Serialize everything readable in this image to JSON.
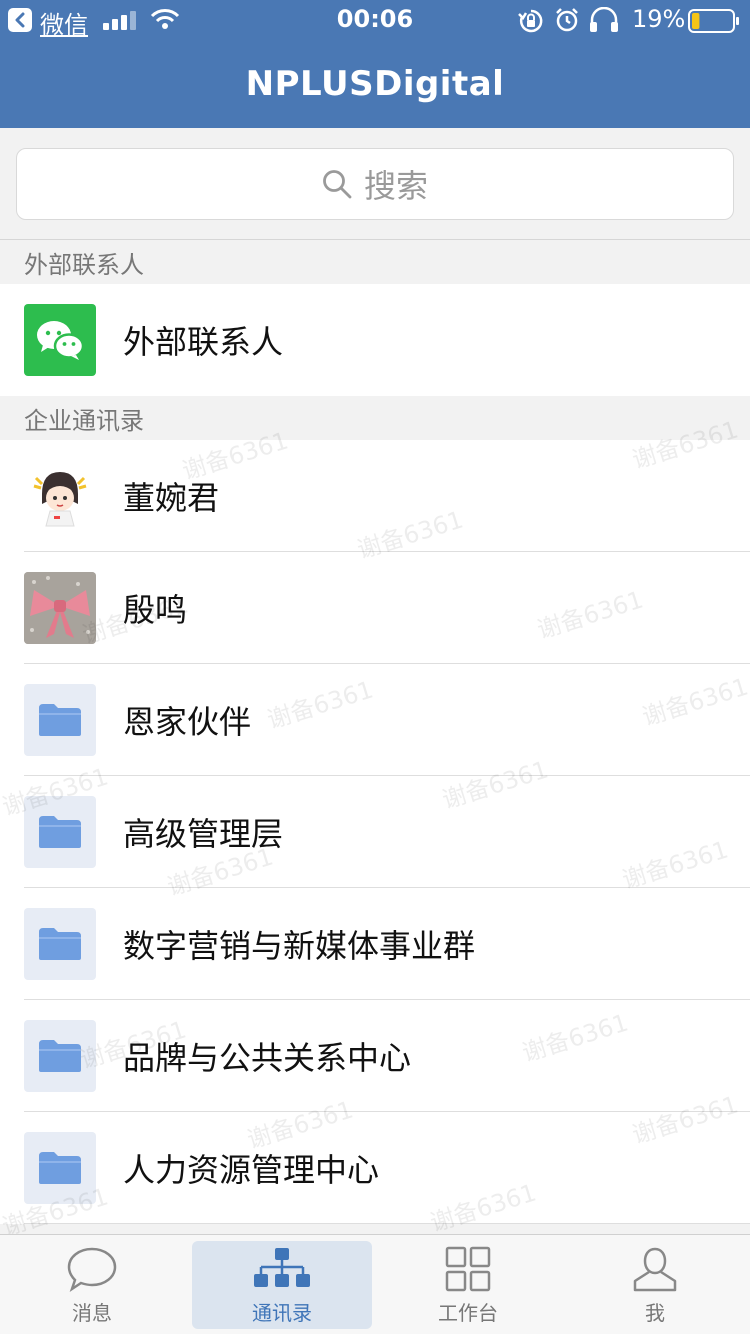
{
  "status_bar": {
    "back_app": "微信",
    "time": "00:06",
    "battery_percent": "19%",
    "battery_level": 0.19,
    "icons": [
      "back-icon",
      "signal-icon",
      "wifi-icon",
      "rotation-lock-icon",
      "alarm-icon",
      "headphone-icon",
      "battery-icon"
    ]
  },
  "header": {
    "title": "NPLUSDigital"
  },
  "search": {
    "placeholder": "搜索"
  },
  "sections": {
    "external": {
      "title": "外部联系人",
      "items": [
        {
          "label": "外部联系人",
          "icon": "wechat-icon"
        }
      ]
    },
    "directory": {
      "title": "企业通讯录",
      "items": [
        {
          "label": "董婉君",
          "icon": "cartoon-avatar"
        },
        {
          "label": "殷鸣",
          "icon": "bow-avatar"
        },
        {
          "label": "恩家伙伴",
          "icon": "folder-icon"
        },
        {
          "label": "高级管理层",
          "icon": "folder-icon"
        },
        {
          "label": "数字营销与新媒体事业群",
          "icon": "folder-icon"
        },
        {
          "label": "品牌与公共关系中心",
          "icon": "folder-icon"
        },
        {
          "label": "人力资源管理中心",
          "icon": "folder-icon"
        }
      ]
    }
  },
  "watermark": "谢备6361",
  "tabbar": {
    "tabs": [
      {
        "label": "消息",
        "icon": "chat-bubble-icon"
      },
      {
        "label": "通讯录",
        "icon": "org-chart-icon",
        "active": true
      },
      {
        "label": "工作台",
        "icon": "grid-icon"
      },
      {
        "label": "我",
        "icon": "person-icon"
      }
    ]
  },
  "colors": {
    "header_bg": "#4a78b4",
    "tab_active": "#3f75b8",
    "wechat_green": "#2dbd4e",
    "folder_blue": "#6f9ee0"
  }
}
